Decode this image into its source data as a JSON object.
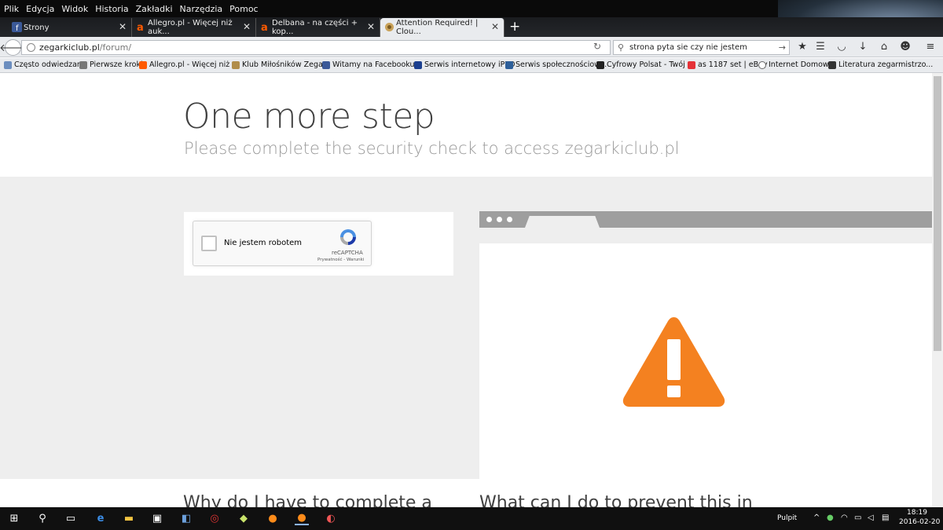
{
  "menu": [
    "Plik",
    "Edycja",
    "Widok",
    "Historia",
    "Zakładki",
    "Narzędzia",
    "Pomoc"
  ],
  "tabs": [
    {
      "title": "Strony",
      "icon": "facebook-icon",
      "active": false
    },
    {
      "title": "Allegro.pl - Więcej niż auk...",
      "icon": "allegro-icon",
      "active": false
    },
    {
      "title": "Delbana - na części + kop...",
      "icon": "allegro-icon",
      "active": false
    },
    {
      "title": "Attention Required! | Clou...",
      "icon": "site-icon",
      "active": true
    }
  ],
  "url": {
    "domain": "zegarkiclub.pl",
    "path": "/forum/"
  },
  "search": {
    "value": "strona pyta sie czy nie jestem"
  },
  "bookmarks": [
    "Często odwiedzane",
    "Pierwsze kroki",
    "Allegro.pl - Więcej niż ...",
    "Klub Miłośników Zega...",
    "Witamy na Facebooku...",
    "Serwis internetowy iPKO",
    "Serwis społecznościow...",
    "Cyfrowy Polsat - Twój ...",
    "as 1187 set | eBay",
    "Internet Domowy",
    "Literatura zegarmistrzo..."
  ],
  "hero": {
    "title": "One more step",
    "subtitle": "Please complete the security check to access zegarkiclub.pl"
  },
  "captcha": {
    "label": "Nie jestem robotem",
    "brand": "reCAPTCHA",
    "links": "Prywatność - Warunki"
  },
  "lower": {
    "left_heading": "Why do I have to complete a",
    "right_heading": "What can I do to prevent this in"
  },
  "taskbar": {
    "desktop_label": "Pulpit",
    "time": "18:19",
    "date": "2016-02-20"
  },
  "colors": {
    "warning": "#f48120",
    "menubar": "#0a0a0a",
    "gray_panel": "#eeeeee"
  }
}
